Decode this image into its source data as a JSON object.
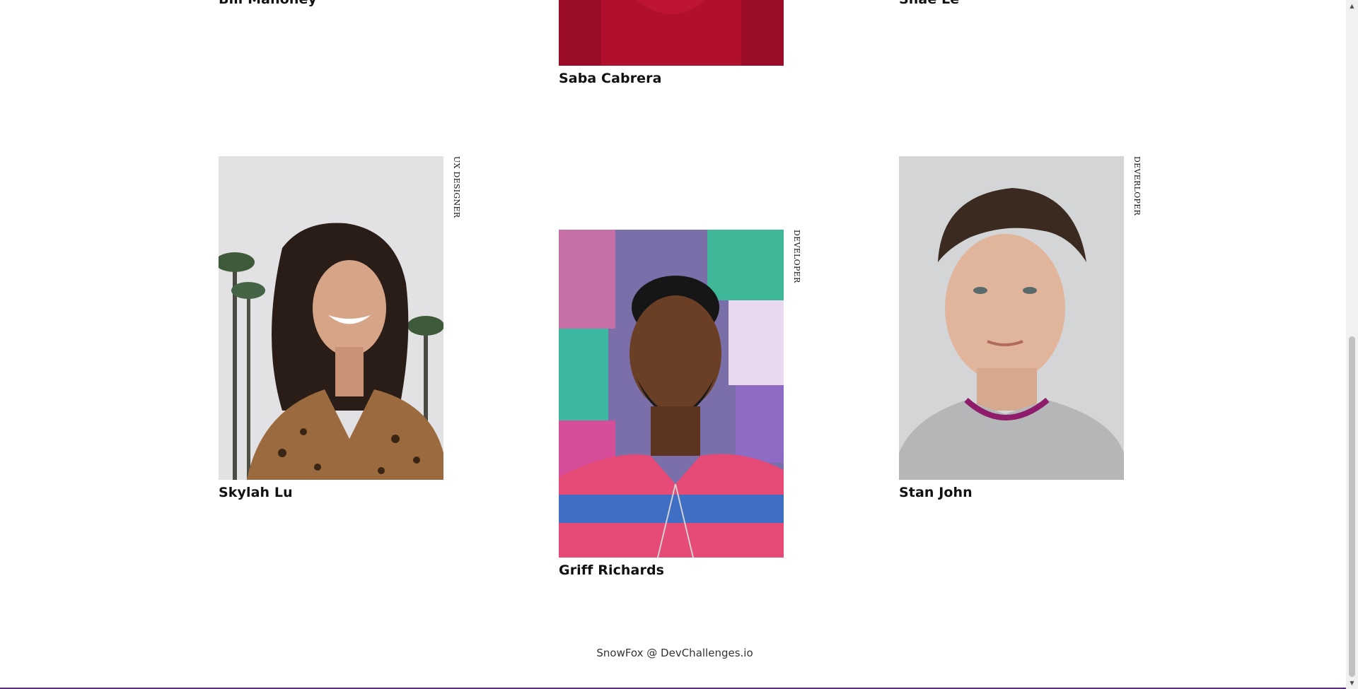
{
  "members": [
    {
      "name": "Bill Mahoney"
    },
    {
      "name": "Saba Cabrera"
    },
    {
      "name": "Shae Le"
    },
    {
      "name": "Skylah Lu",
      "role": "UX DESIGNER"
    },
    {
      "name": "Griff Richards",
      "role": "DEVELOPER"
    },
    {
      "name": "Stan John",
      "role": "DEVERLOPER"
    }
  ],
  "footer": {
    "text": "SnowFox @ DevChallenges.io"
  },
  "colors": {
    "background": "#ffffff",
    "text": "#111111",
    "accent_bar": "#5b2a86"
  }
}
